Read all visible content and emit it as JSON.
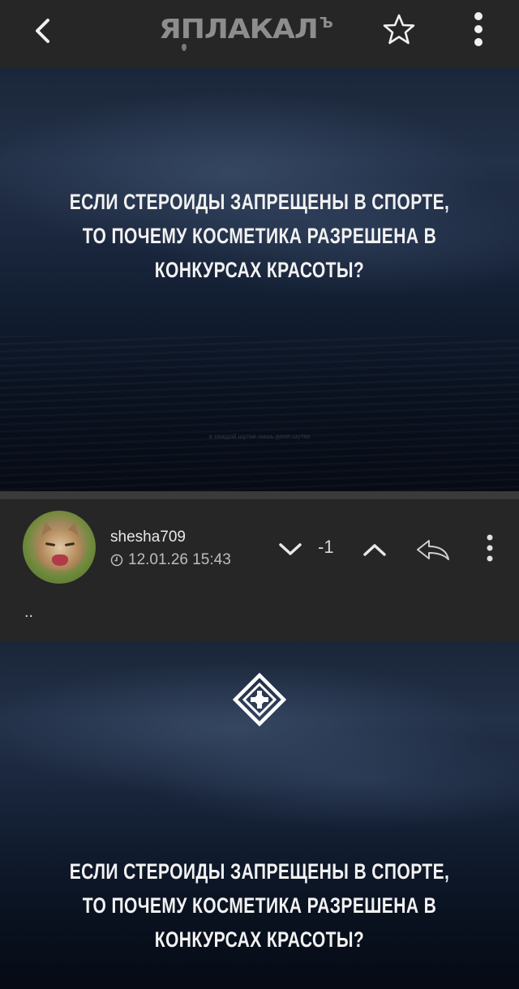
{
  "header": {
    "back_icon": "chevron-left-icon",
    "logo_text": "ЯПЛАКАЛ",
    "logo_suffix": "Ъ",
    "favorite_icon": "star-outline-icon",
    "menu_icon": "vertical-dots-icon"
  },
  "post": {
    "image_caption_lines": [
      "ЕСЛИ СТЕРОИДЫ ЗАПРЕЩЕНЫ В СПОРТЕ,",
      "ТО ПОЧЕМУ КОСМЕТИКА РАЗРЕШЕНА В",
      "КОНКУРСАХ КРАСОТЫ?"
    ],
    "image_watermark": "в каждой шутке лишь доля шутки"
  },
  "comment": {
    "username": "shesha709",
    "datetime": "12.01.26 15:43",
    "rating": "-1",
    "text": "..",
    "image_caption_lines": [
      "ЕСЛИ СТЕРОИДЫ ЗАПРЕЩЕНЫ В СПОРТЕ,",
      "ТО ПОЧЕМУ КОСМЕТИКА РАЗРЕШЕНА В",
      "КОНКУРСАХ КРАСОТЫ?"
    ]
  },
  "colors": {
    "topbar_bg": "#262626",
    "page_bg": "#1c1c1c",
    "icon_light": "#f0f0f0",
    "logo_gray": "#8d8d8d"
  }
}
